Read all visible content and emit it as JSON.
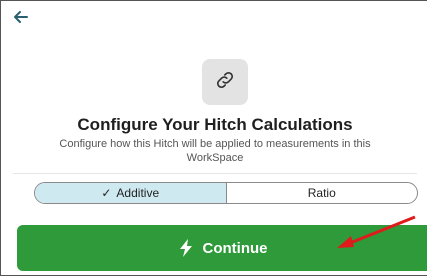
{
  "header": {
    "back_icon": "back-arrow-icon"
  },
  "hero": {
    "icon": "link-icon",
    "title": "Configure Your Hitch Calculations",
    "subtitle": "Configure how this Hitch will be applied to measurements in this WorkSpace"
  },
  "mode_toggle": {
    "options": [
      {
        "label": "Additive",
        "selected": true
      },
      {
        "label": "Ratio",
        "selected": false
      }
    ]
  },
  "continue_button": {
    "label": "Continue",
    "icon": "lightning-bolt-icon",
    "color": "#2f9a3a"
  },
  "annotation": {
    "arrow_color": "#e01b1b"
  }
}
